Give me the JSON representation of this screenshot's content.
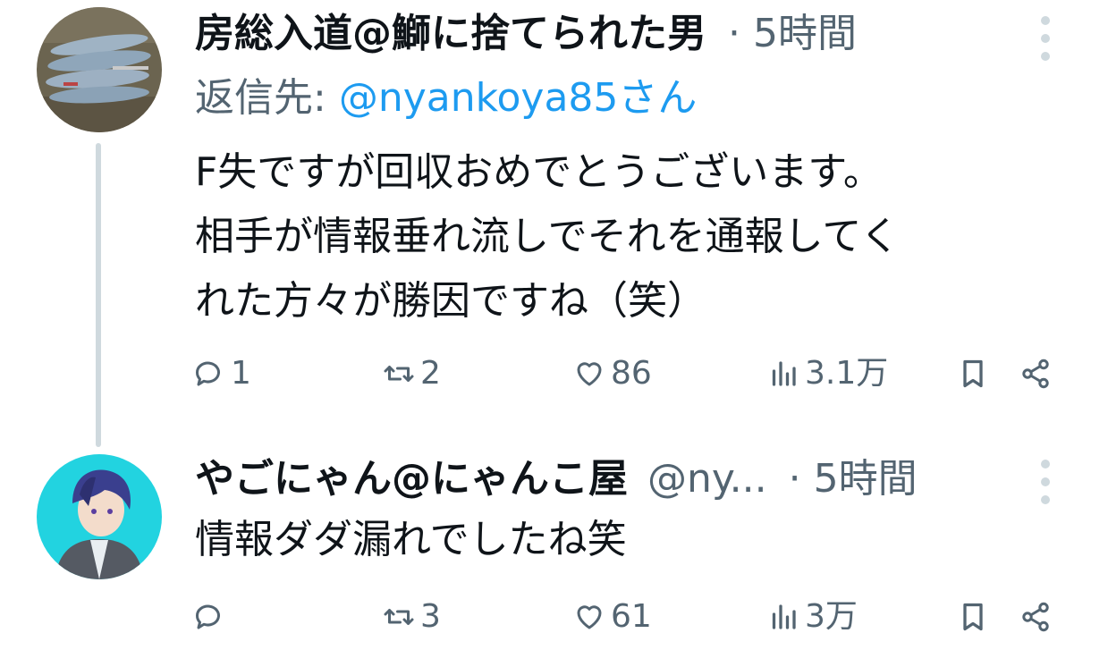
{
  "tweets": [
    {
      "author_name": "房総入道@鰤に捨てられた男",
      "separator": "·",
      "time": "5時間",
      "reply_prefix": "返信先: ",
      "reply_handle": "@nyankoya85さん",
      "text": "F失ですが回収おめでとうございます。\n相手が情報垂れ流しでそれを通報してく\nれた方々が勝因ですね（笑）",
      "stats": {
        "replies": "1",
        "retweets": "2",
        "likes": "86",
        "views": "3.1万"
      }
    },
    {
      "author_name": "やごにゃん@にゃんこ屋",
      "handle": "@ny...",
      "separator": "·",
      "time": "5時間",
      "text": "情報ダダ漏れでしたね笑",
      "stats": {
        "replies": "",
        "retweets": "3",
        "likes": "61",
        "views": "3万"
      }
    }
  ],
  "colors": {
    "text": "#0f1419",
    "secondary": "#536471",
    "link": "#1d9bf0",
    "thread_line": "#cfd9de"
  },
  "icons": [
    "reply-icon",
    "retweet-icon",
    "like-icon",
    "views-icon",
    "bookmark-icon",
    "share-icon",
    "more-icon"
  ]
}
